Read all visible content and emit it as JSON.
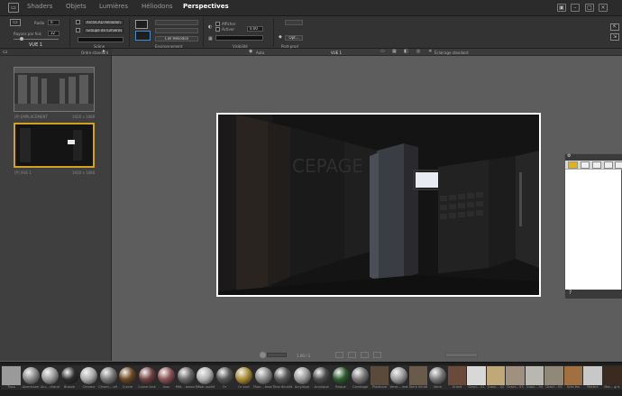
{
  "menu": {
    "tabs": [
      "Shaders",
      "Objets",
      "Lumières",
      "Héliodons",
      "Perspectives"
    ],
    "active_tab": "Perspectives"
  },
  "toolbar": {
    "view_label": "VUE 1",
    "radio_label": "Radio",
    "radio_value": "0",
    "rays_label": "Rayons par fois",
    "rays_value": "32",
    "engine_select": "ArchiCAD Héliodon",
    "lights_select": "Groupe de lumières",
    "section_scene": "Scène",
    "section_env": "Environnement",
    "env_btn1": "Ciel Héliodon",
    "afficher_label": "Afficher",
    "activer_label": "Activer",
    "activer_value": "0.00",
    "section_visibility": "Visibilité",
    "section_postprod": "Post-prod",
    "btn_opt": "Opt..."
  },
  "leftpanel": {
    "sort_label": "Ordre standard",
    "thumbs": [
      {
        "caption": "[P] EMPLACEMENT",
        "size": "1920 x 1080"
      },
      {
        "caption": "[P] VUE 1",
        "size": "1920 x 1080"
      }
    ]
  },
  "viewport_header": {
    "left_label": "Auto",
    "center_label": "VUE 1",
    "right_label": "Éclairage standard"
  },
  "render": {
    "sign_text": "CEPAGE"
  },
  "bottombar": {
    "zoom_value": "1.00 / 1"
  },
  "floatpanel": {
    "help_glyph": "?"
  },
  "materials": [
    {
      "label": "Tissu",
      "kind": "sq",
      "color": "#9a9a9a"
    },
    {
      "label": "Aluminium",
      "kind": "ball",
      "color": "#888"
    },
    {
      "label": "Alu... chaud",
      "kind": "ball",
      "color": "#999"
    },
    {
      "label": "Bronze",
      "kind": "ball",
      "color": "#2c2c2c"
    },
    {
      "label": "Chrome",
      "kind": "ball",
      "color": "#aaa"
    },
    {
      "label": "Chrom... ufé",
      "kind": "ball",
      "color": "#777"
    },
    {
      "label": "Cuivre",
      "kind": "ball",
      "color": "#6b4620"
    },
    {
      "label": "Cuivre brut",
      "kind": "ball",
      "color": "#704040"
    },
    {
      "label": "Inox",
      "kind": "ball",
      "color": "#8a5050"
    },
    {
      "label": "Mét... brossé",
      "kind": "ball",
      "color": "#666"
    },
    {
      "label": "Métal rouillé",
      "kind": "ball",
      "color": "#b0b0b0"
    },
    {
      "label": "Or",
      "kind": "ball",
      "color": "#555"
    },
    {
      "label": "Or brut",
      "kind": "ball",
      "color": "#a88a30"
    },
    {
      "label": "Titan... brossé",
      "kind": "ball",
      "color": "#8a8a8a"
    },
    {
      "label": "Titan émaillé",
      "kind": "ball",
      "color": "#555"
    },
    {
      "label": "Acrylique",
      "kind": "ball",
      "color": "#999"
    },
    {
      "label": "Acrylique",
      "kind": "ball",
      "color": "#4a4a4a"
    },
    {
      "label": "Brique",
      "kind": "ball",
      "color": "#2e5a2e"
    },
    {
      "label": "Carrelage",
      "kind": "ball",
      "color": "#777"
    },
    {
      "label": "Plastique",
      "kind": "sq",
      "color": "#5a4a3a"
    },
    {
      "label": "Verre... mat",
      "kind": "ball",
      "color": "#999"
    },
    {
      "label": "Verre teinté",
      "kind": "sq",
      "color": "#6a5a4a"
    },
    {
      "label": "Verre",
      "kind": "ball",
      "color": "#777"
    },
    {
      "label": "Granit",
      "kind": "sq",
      "color": "#6a4a3a"
    },
    {
      "label": "Gravi... 01",
      "kind": "sq",
      "color": "#d8d8d8"
    },
    {
      "label": "Gravi... 02",
      "kind": "sq",
      "color": "#c0a878"
    },
    {
      "label": "Gravi... 03",
      "kind": "sq",
      "color": "#a09080"
    },
    {
      "label": "Gravi... 04",
      "kind": "sq",
      "color": "#b8b8b0"
    },
    {
      "label": "Gravi... 05",
      "kind": "sq",
      "color": "#908878"
    },
    {
      "label": "Grès fini",
      "kind": "sq",
      "color": "#a07040"
    },
    {
      "label": "Marbre",
      "kind": "sq",
      "color": "#c8c8c8"
    },
    {
      "label": "Mar... gris",
      "kind": "sq",
      "color": "#3a2a20"
    }
  ]
}
